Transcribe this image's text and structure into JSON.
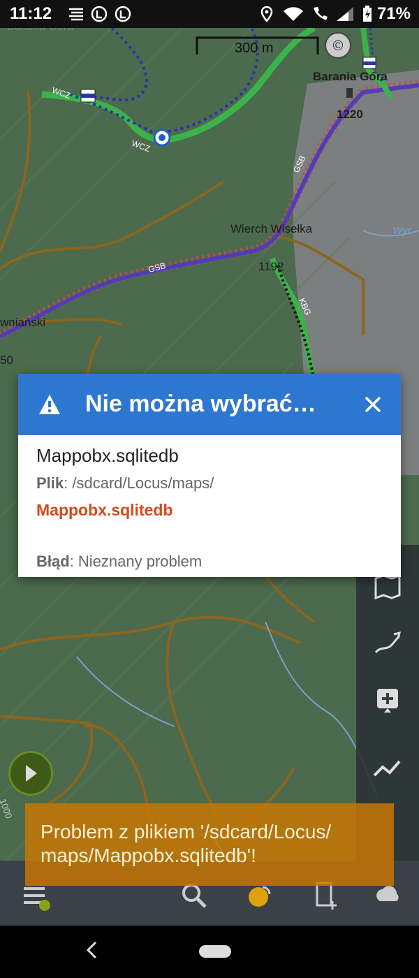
{
  "status_bar": {
    "time": "11:12",
    "battery": "71%"
  },
  "map": {
    "labels": {
      "peak": "Barania Góra",
      "peak_elevation": "1220",
      "place": "Wierch Wisełka",
      "place_elevation": "1192",
      "left_place": "wniański",
      "left_number": "50",
      "river": "Wyr",
      "trail_gsb_1": "GSB",
      "trail_gsb_2": "GSB",
      "trail_kbg": "KBG",
      "trail_wcz_1": "WCZ",
      "trail_wcz_2": "WCZ",
      "top_left": "Barania Góra",
      "contour": "1000"
    },
    "scale": "300 m"
  },
  "dialog": {
    "title": "Nie można wybrać…",
    "filename": "Mappobx.sqlitedb",
    "file_label": "Plik",
    "file_path": ": /sdcard/Locus/maps/",
    "file_link": "Mappobx.sqlitedb",
    "error_label": "Błąd",
    "error_value": ": Nieznany problem"
  },
  "toast": {
    "message": "Problem z plikiem '/sdcard/Locus/ maps/Mappobx.sqlitedb'!"
  },
  "colors": {
    "dialog_header": "#2d77d0",
    "link": "#d44a1a",
    "toast": "#cc7700"
  }
}
